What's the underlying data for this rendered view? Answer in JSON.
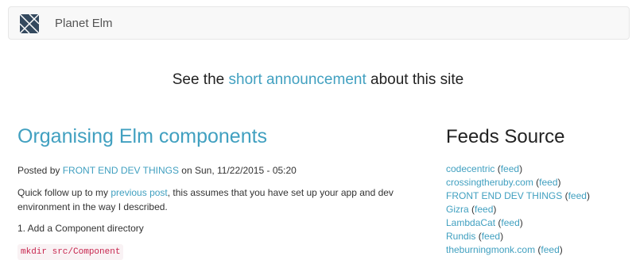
{
  "navbar": {
    "brand": "Planet Elm"
  },
  "announcement": {
    "prefix": "See the ",
    "link": "short announcement",
    "suffix": " about this site"
  },
  "post": {
    "title": "Organising Elm components",
    "meta_prefix": "Posted by ",
    "author": "FRONT END DEV THINGS",
    "meta_suffix": " on Sun, 11/22/2015 - 05:20",
    "intro_prefix": "Quick follow up to my ",
    "intro_link": "previous post",
    "intro_suffix": ", this assumes that you have set up your app and dev environment in the way I described.",
    "step1": "1. Add a Component directory",
    "code": "mkdir src/Component"
  },
  "feeds": {
    "title": "Feeds Source",
    "feed_label": "feed",
    "items": [
      {
        "name": "codecentric"
      },
      {
        "name": "crossingtheruby.com"
      },
      {
        "name": "FRONT END DEV THINGS"
      },
      {
        "name": "Gizra"
      },
      {
        "name": "LambdaCat"
      },
      {
        "name": "Rundis"
      },
      {
        "name": "theburningmonk.com"
      }
    ]
  }
}
